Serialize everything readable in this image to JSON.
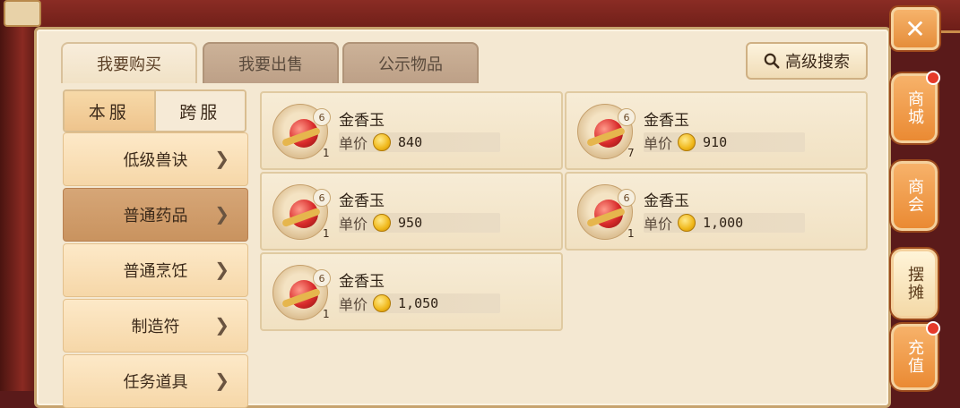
{
  "header": {
    "close_glyph": "✕"
  },
  "tabs": [
    {
      "label": "我要购买",
      "active": true
    },
    {
      "label": "我要出售",
      "active": false
    },
    {
      "label": "公示物品",
      "active": false
    }
  ],
  "search": {
    "label": "高级搜索",
    "icon": "search-icon"
  },
  "server_toggle": [
    {
      "label": "本服",
      "active": true
    },
    {
      "label": "跨服",
      "active": false
    }
  ],
  "categories": [
    {
      "label": "低级兽诀",
      "active": false
    },
    {
      "label": "普通药品",
      "active": true
    },
    {
      "label": "普通烹饪",
      "active": false
    },
    {
      "label": "制造符",
      "active": false
    },
    {
      "label": "任务道具",
      "active": false
    }
  ],
  "items": [
    {
      "name": "金香玉",
      "price_label": "单价",
      "price": "840",
      "quantity": "1",
      "level": "6"
    },
    {
      "name": "金香玉",
      "price_label": "单价",
      "price": "910",
      "quantity": "7",
      "level": "6"
    },
    {
      "name": "金香玉",
      "price_label": "单价",
      "price": "950",
      "quantity": "1",
      "level": "6"
    },
    {
      "name": "金香玉",
      "price_label": "单价",
      "price": "1,000",
      "quantity": "1",
      "level": "6"
    },
    {
      "name": "金香玉",
      "price_label": "单价",
      "price": "1,050",
      "quantity": "1",
      "level": "6"
    }
  ],
  "side_nav": [
    {
      "label": "商城",
      "active": false,
      "notify": true
    },
    {
      "label": "商会",
      "active": false,
      "notify": false
    },
    {
      "label": "摆摊",
      "active": true,
      "notify": false
    },
    {
      "label": "充值",
      "active": false,
      "notify": true
    }
  ],
  "colors": {
    "accent": "#ea8a33",
    "notify": "#e53a2a",
    "coin": "#f0b81b"
  }
}
